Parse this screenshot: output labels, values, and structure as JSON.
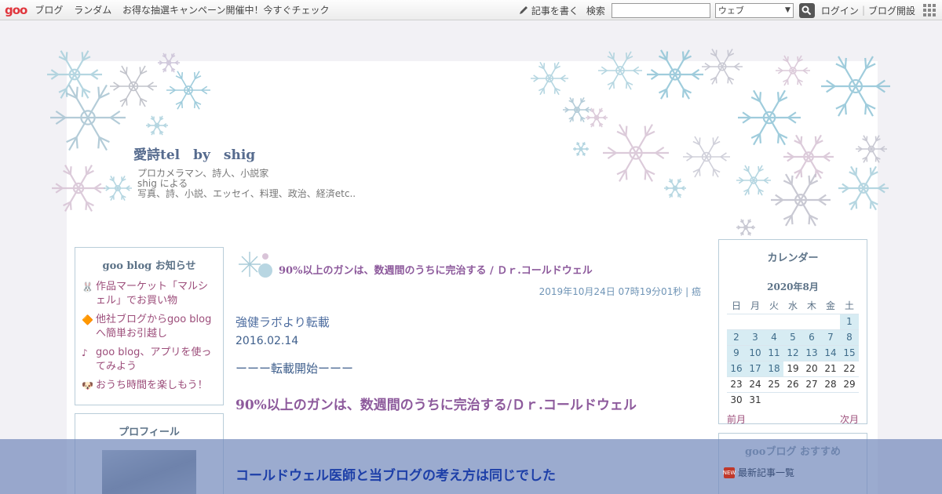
{
  "topbar": {
    "logo": "goo",
    "nav": [
      "ブログ",
      "ランダム",
      "お得な抽選キャンペーン開催中！今すぐチェック"
    ],
    "write_label": "記事を書く",
    "search_label": "検索",
    "search_placeholder": "",
    "search_type": "ウェブ",
    "login": "ログイン",
    "open_blog": "ブログ開設"
  },
  "blog": {
    "title": "愛詩tel　by　shig",
    "desc_line1": "プロカメラマン、詩人、小説家",
    "desc_line2": "shig による",
    "desc_line3": "写真、詩、小説、エッセイ、料理、政治、経済etc.."
  },
  "notice": {
    "title": "goo blog お知らせ",
    "items": [
      {
        "icon": "🐰",
        "text": "作品マーケット「マルシェル」でお買い物"
      },
      {
        "icon": "🔶",
        "text": "他社ブログからgoo blogへ簡単お引越し"
      },
      {
        "icon": "♪",
        "text": "goo blog、アプリを使ってみよう"
      },
      {
        "icon": "🐶",
        "text": "おうち時間を楽しもう！"
      }
    ]
  },
  "profile": {
    "title": "プロフィール"
  },
  "post": {
    "title": "90%以上のガンは、数週間のうちに完治する / Ｄｒ.コールドウェル",
    "meta": "2019年10月24日 07時19分01秒 | 癌",
    "line1": "強健ラボより転載",
    "line2": "2016.02.14",
    "line3": "ーーー転載開始ーーー",
    "heading": "90%以上のガンは、数週間のうちに完治する/Ｄｒ.コールドウェル",
    "overlay_heading": "コールドウェル医師と当ブログの考え方は同じでした"
  },
  "calendar": {
    "title": "カレンダー",
    "month": "2020年8月",
    "weekdays": [
      "日",
      "月",
      "火",
      "水",
      "木",
      "金",
      "土"
    ],
    "weeks": [
      [
        "",
        "",
        "",
        "",
        "",
        "",
        "1"
      ],
      [
        "2",
        "3",
        "4",
        "5",
        "6",
        "7",
        "8"
      ],
      [
        "9",
        "10",
        "11",
        "12",
        "13",
        "14",
        "15"
      ],
      [
        "16",
        "17",
        "18",
        "19",
        "20",
        "21",
        "22"
      ],
      [
        "23",
        "24",
        "25",
        "26",
        "27",
        "28",
        "29"
      ],
      [
        "30",
        "31",
        "",
        "",
        "",
        "",
        ""
      ]
    ],
    "posted_days": [
      "1",
      "2",
      "3",
      "4",
      "5",
      "6",
      "7",
      "8",
      "9",
      "10",
      "11",
      "12",
      "13",
      "14",
      "15",
      "16",
      "17",
      "18"
    ],
    "prev": "前月",
    "next": "次月"
  },
  "recommend": {
    "title": "gooブログ おすすめ",
    "item": "最新記事一覧",
    "item_icon": "NEW"
  }
}
